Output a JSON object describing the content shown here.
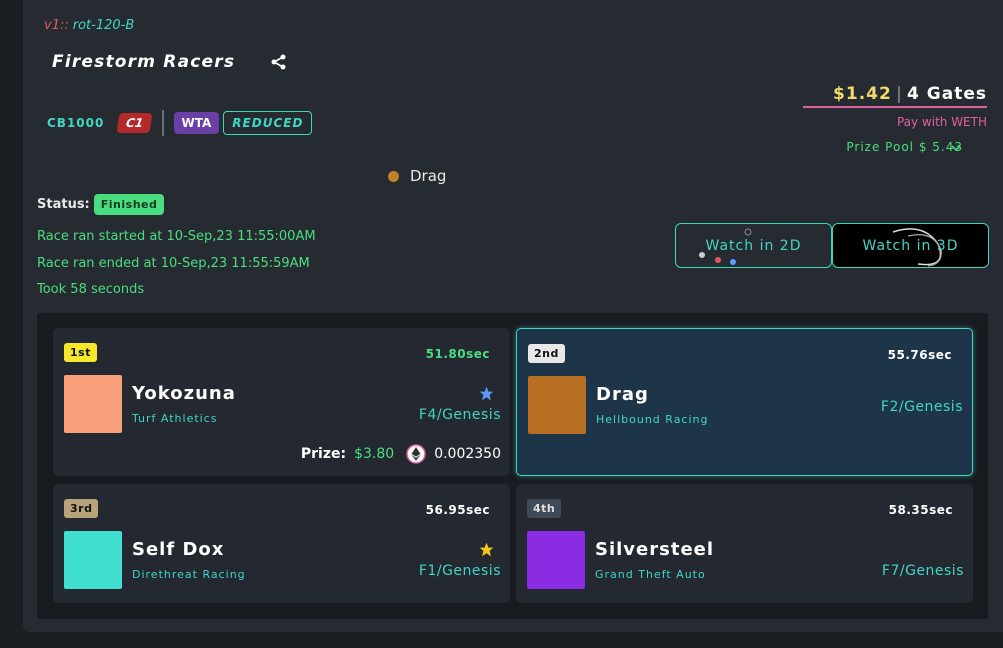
{
  "version": {
    "prefix": "v1::",
    "code": "rot-120-B"
  },
  "race": {
    "title": "Firestorm Racers"
  },
  "tags": {
    "class": "CB1000",
    "c1": "C1",
    "wta": "WTA",
    "reduced": "REDUCED"
  },
  "entry": {
    "price": "$1.42",
    "separator": "|",
    "gates": "4 Gates",
    "pay_with": "Pay with WETH",
    "prize_pool": "Prize Pool $ 5.43"
  },
  "winner": {
    "name": "Drag",
    "color": "#c47f2a"
  },
  "status": {
    "label": "Status:",
    "value": "Finished"
  },
  "info": {
    "started": "Race ran started at 10-Sep,23 11:55:00AM",
    "ended": "Race ran ended at 10-Sep,23 11:55:59AM",
    "took": "Took 58 seconds"
  },
  "watch": {
    "two_d": "Watch in 2D",
    "three_d": "Watch in 3D"
  },
  "results": [
    {
      "place": "1st",
      "place_bg": "#f5e82a",
      "place_fg": "#111111",
      "time": "51.80sec",
      "time_color": "#4ade80",
      "color": "#f9a07a",
      "name": "Yokozuna",
      "team": "Turf Athletics",
      "gen": "F4/Genesis",
      "star": "blue-star-icon",
      "prize_label": "Prize:",
      "prize_usd": "$3.80",
      "prize_eth": "0.002350"
    },
    {
      "place": "2nd",
      "place_bg": "#e8e8e8",
      "place_fg": "#111111",
      "time": "55.76sec",
      "time_color": "#ffffff",
      "color": "#b86f24",
      "name": "Drag",
      "team": "Hellbound Racing",
      "gen": "F2/Genesis"
    },
    {
      "place": "3rd",
      "place_bg": "#b8a27a",
      "place_fg": "#111111",
      "time": "56.95sec",
      "time_color": "#ffffff",
      "color": "#3fe0cf",
      "name": "Self Dox",
      "team": "Direthreat Racing",
      "gen": "F1/Genesis",
      "star": "gold-star-icon"
    },
    {
      "place": "4th",
      "place_bg": "#3f4a58",
      "place_fg": "#e0e0e0",
      "time": "58.35sec",
      "time_color": "#ffffff",
      "color": "#8b2be2",
      "name": "Silversteel",
      "team": "Grand Theft Auto",
      "gen": "F7/Genesis"
    }
  ]
}
